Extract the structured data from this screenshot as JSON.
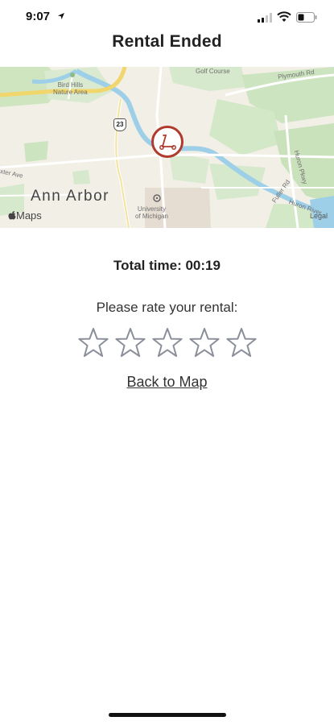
{
  "status_bar": {
    "time": "9:07",
    "icons": [
      "location-arrow-icon",
      "cellular-signal-icon",
      "wifi-icon",
      "battery-icon"
    ]
  },
  "header": {
    "title": "Rental Ended"
  },
  "map": {
    "labels": {
      "bird_hills": "Bird Hills\nNature Area",
      "golf_course": "Golf Course",
      "plymouth_rd": "Plymouth Rd",
      "huron_pkwy": "Huron Pkwy",
      "fuller_rd": "Fuller Rd",
      "huron_river": "Huron River",
      "dexter_ave": "xter Ave",
      "university": "University\nof Michigan",
      "city": "Ann Arbor",
      "highway": "23"
    },
    "brand": "Maps",
    "legal": "Legal",
    "marker_icon": "scooter-icon",
    "accent_color": "#b03a2e"
  },
  "summary": {
    "total_time": "Total time: 00:19"
  },
  "rating": {
    "prompt": "Please rate your rental:",
    "max_stars": 5,
    "selected": 0,
    "star_icon": "star-outline-icon"
  },
  "actions": {
    "back_to_map": "Back to Map"
  }
}
